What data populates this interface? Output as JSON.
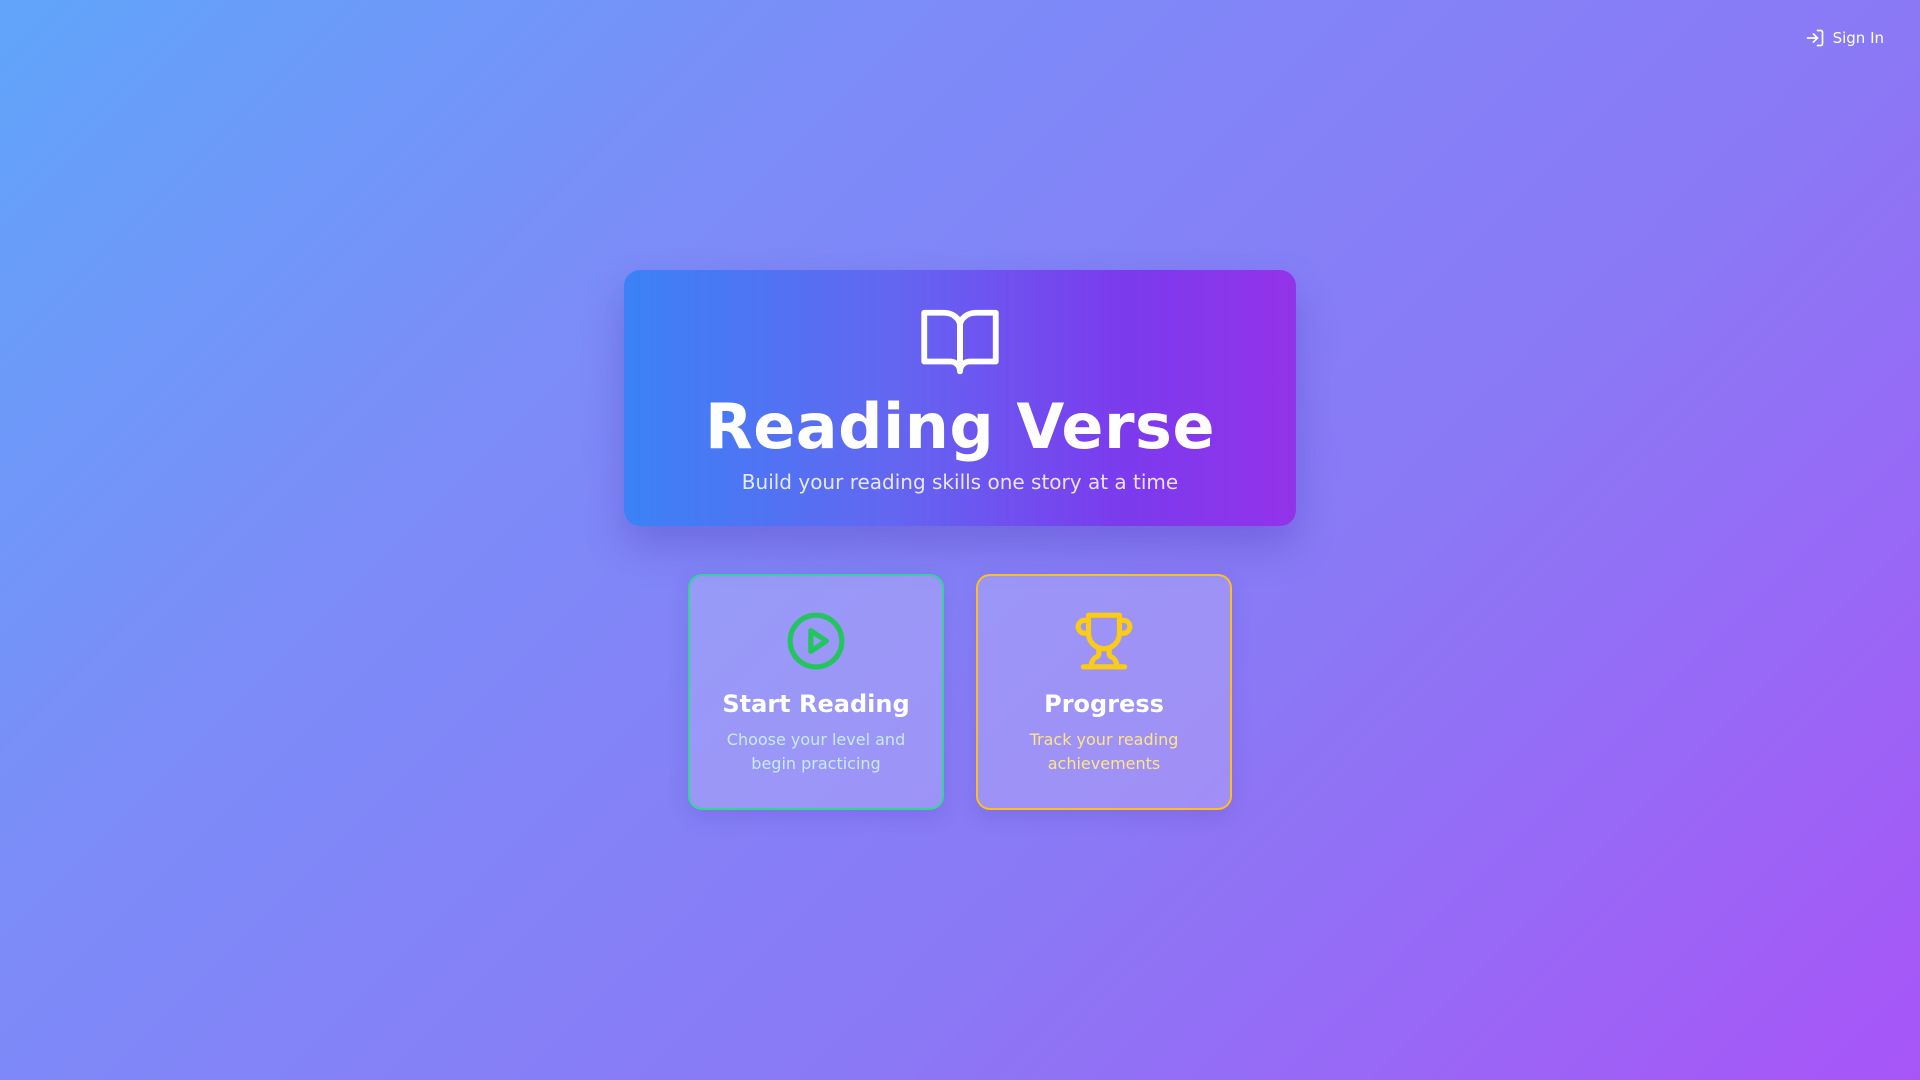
{
  "header": {
    "signin_label": "Sign In",
    "signin_icon": "log-in-icon"
  },
  "hero": {
    "icon": "book-open-icon",
    "title": "Reading Verse",
    "subtitle": "Build your reading skills one story at a time"
  },
  "cards": [
    {
      "icon": "play-circle-icon",
      "title": "Start Reading",
      "description": "Choose your level and begin practicing",
      "accent": "#22c55e"
    },
    {
      "icon": "trophy-icon",
      "title": "Progress",
      "description": "Track your reading achievements",
      "accent": "#facc15"
    }
  ]
}
